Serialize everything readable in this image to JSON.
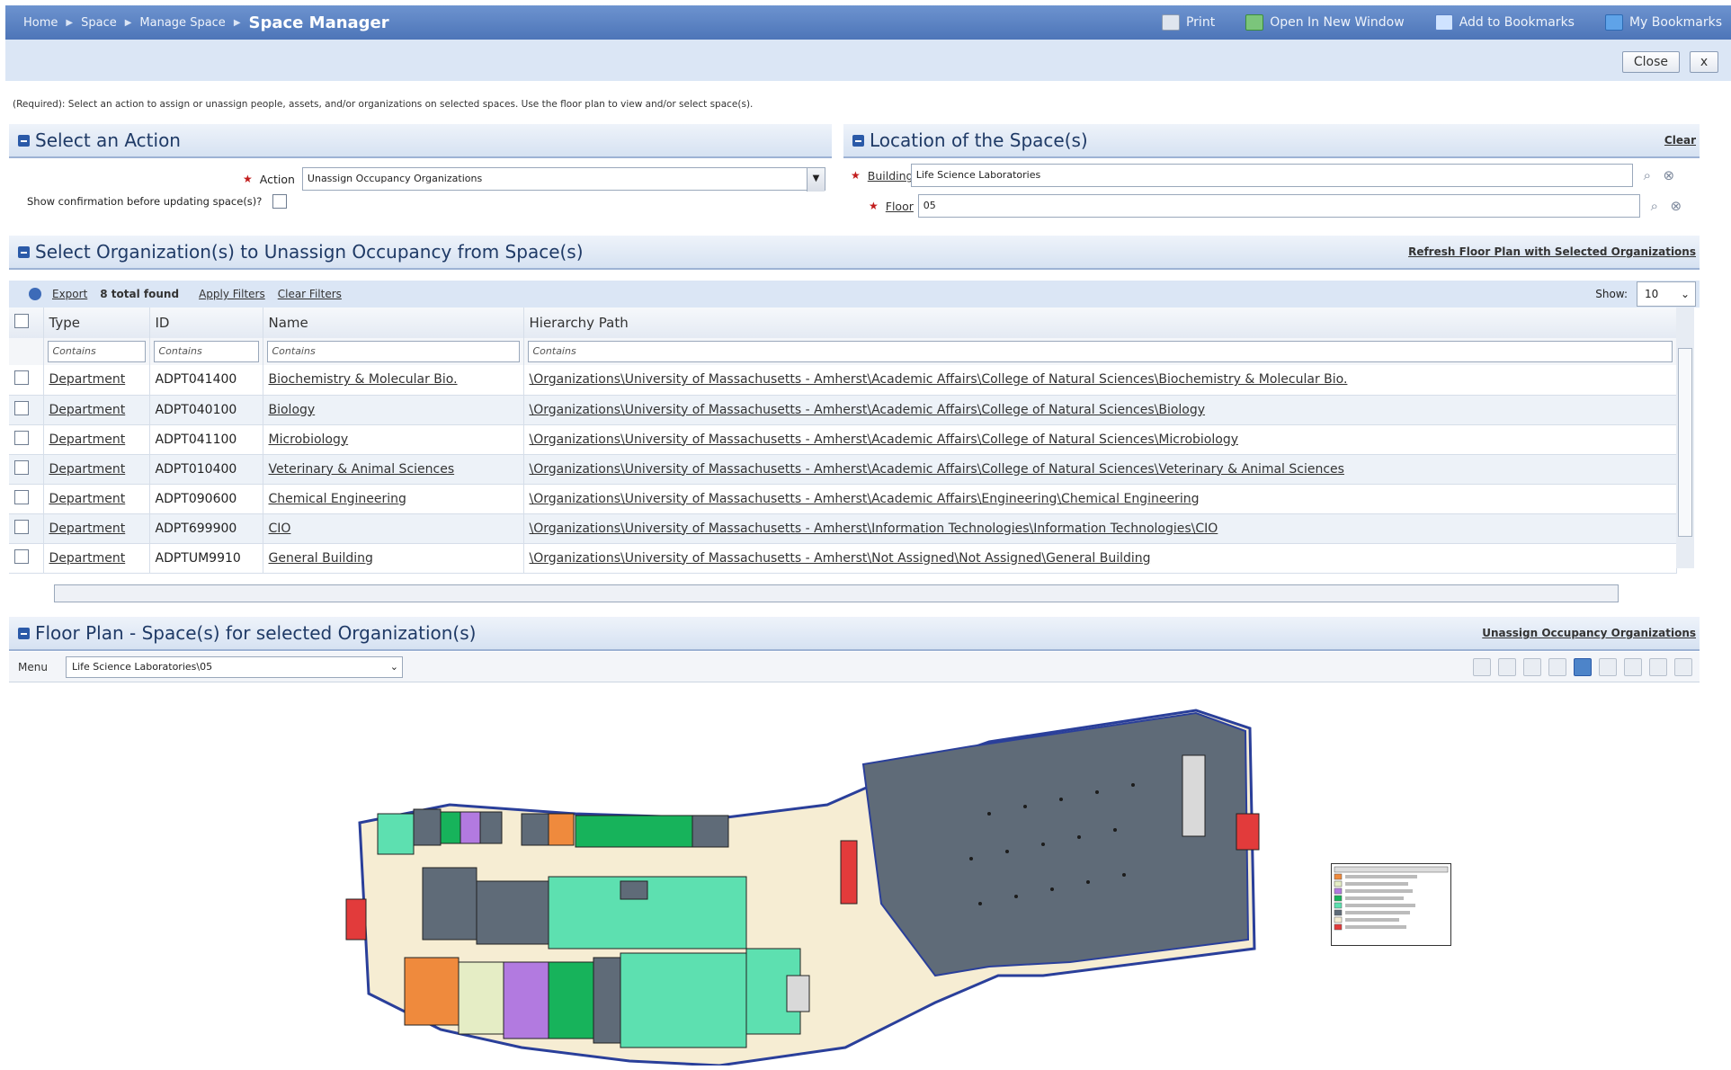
{
  "breadcrumb": {
    "items": [
      "Home",
      "Space",
      "Manage Space"
    ],
    "current": "Space Manager"
  },
  "top_actions": {
    "print": "Print",
    "open_new_window": "Open In New Window",
    "add_bookmarks": "Add to Bookmarks",
    "my_bookmarks": "My Bookmarks"
  },
  "window_buttons": {
    "close": "Close",
    "x": "x"
  },
  "instructions": "(Required): Select an action to assign or unassign people, assets, and/or organizations on selected spaces. Use the floor plan to view and/or select space(s).",
  "action_panel": {
    "title": "Select an Action",
    "action_label": "Action",
    "action_value": "Unassign Occupancy Organizations",
    "confirm_label": "Show confirmation before updating space(s)?"
  },
  "location_panel": {
    "title": "Location of the Space(s)",
    "clear_link": "Clear",
    "building_label": "Building",
    "building_value": "Life Science Laboratories",
    "floor_label": "Floor",
    "floor_value": "05"
  },
  "org_panel": {
    "title": "Select Organization(s) to Unassign Occupancy from Space(s)",
    "refresh_link": "Refresh Floor Plan with Selected Organizations",
    "export": "Export",
    "total_found": "8 total found",
    "apply_filters": "Apply Filters",
    "clear_filters": "Clear Filters",
    "show_label": "Show:",
    "show_value": "10",
    "columns": [
      "Type",
      "ID",
      "Name",
      "Hierarchy Path"
    ],
    "filter_placeholder": "Contains",
    "rows": [
      {
        "type": "Department",
        "id": "ADPT041400",
        "name": "Biochemistry & Molecular Bio.",
        "path": "\\Organizations\\University of Massachusetts - Amherst\\Academic Affairs\\College of Natural Sciences\\Biochemistry & Molecular Bio."
      },
      {
        "type": "Department",
        "id": "ADPT040100",
        "name": "Biology",
        "path": "\\Organizations\\University of Massachusetts - Amherst\\Academic Affairs\\College of Natural Sciences\\Biology"
      },
      {
        "type": "Department",
        "id": "ADPT041100",
        "name": "Microbiology",
        "path": "\\Organizations\\University of Massachusetts - Amherst\\Academic Affairs\\College of Natural Sciences\\Microbiology"
      },
      {
        "type": "Department",
        "id": "ADPT010400",
        "name": "Veterinary & Animal Sciences",
        "path": "\\Organizations\\University of Massachusetts - Amherst\\Academic Affairs\\College of Natural Sciences\\Veterinary & Animal Sciences"
      },
      {
        "type": "Department",
        "id": "ADPT090600",
        "name": "Chemical Engineering",
        "path": "\\Organizations\\University of Massachusetts - Amherst\\Academic Affairs\\Engineering\\Chemical Engineering"
      },
      {
        "type": "Department",
        "id": "ADPT699900",
        "name": "CIO",
        "path": "\\Organizations\\University of Massachusetts - Amherst\\Information Technologies\\Information Technologies\\CIO"
      },
      {
        "type": "Department",
        "id": "ADPTUM9910",
        "name": "General Building",
        "path": "\\Organizations\\University of Massachusetts - Amherst\\Not Assigned\\Not Assigned\\General Building"
      }
    ]
  },
  "floorplan_panel": {
    "title": "Floor Plan - Space(s) for selected Organization(s)",
    "unassign_link": "Unassign Occupancy Organizations",
    "menu_label": "Menu",
    "drawing_value": "Life Science Laboratories\\05"
  },
  "colors": {
    "header_blue": "#4d75b8",
    "panel_title": "#1f3a66",
    "room_gray": "#5f6b78",
    "room_mint": "#5de0b0",
    "room_orange": "#ef8a3d",
    "room_purple": "#b27ae0",
    "room_green": "#17b35b",
    "corridor": "#f6edd3"
  }
}
